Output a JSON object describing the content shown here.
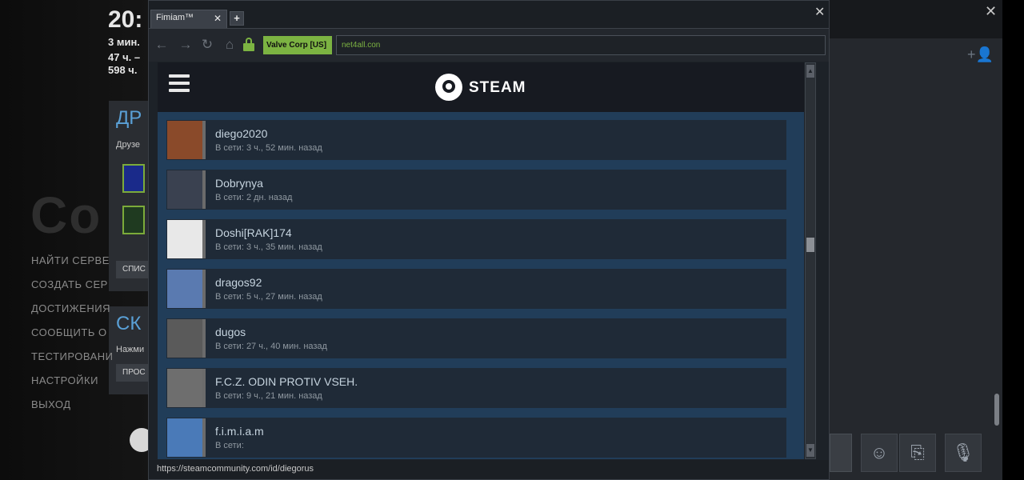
{
  "background": {
    "clock": "20:",
    "stats": [
      "3 мин.",
      "47 ч. –",
      "598 ч."
    ],
    "big_text": "Co",
    "menu": [
      "НАЙТИ СЕРВЕ",
      "СОЗДАТЬ СЕР",
      "ДОСТИЖЕНИЯ",
      "СООБЩИТЬ О",
      "ТЕСТИРОВАНИ",
      "НАСТРОЙКИ",
      "ВЫХОД"
    ],
    "friends_title": "ДР",
    "friends_sub": "Друзе",
    "friends_button": "СПИС",
    "section2_title": "СК",
    "section2_sub": "Нажми",
    "section2_button": "ПРОС"
  },
  "window": {
    "tab_label": "Fimiam™",
    "tab_close": "✕",
    "new_tab": "+",
    "close": "✕"
  },
  "navbar": {
    "back_icon": "←",
    "forward_icon": "→",
    "reload_icon": "↻",
    "home_icon": "⌂",
    "cert_label": "Valve Corp [US]",
    "url": "net4all.con"
  },
  "page": {
    "brand": "STEAM",
    "friends": [
      {
        "name": "diego2020",
        "status": "В сети: 3 ч., 52 мин. назад",
        "avatar_color": "#8a4a2a"
      },
      {
        "name": "Dobrynya",
        "status": "В сети: 2 дн. назад",
        "avatar_color": "#3a4150"
      },
      {
        "name": "Doshi[RAK]174",
        "status": "В сети: 3 ч., 35 мин. назад",
        "avatar_color": "#e8e8e8"
      },
      {
        "name": "dragos92",
        "status": "В сети: 5 ч., 27 мин. назад",
        "avatar_color": "#5a7ab0"
      },
      {
        "name": "dugos",
        "status": "В сети: 27 ч., 40 мин. назад",
        "avatar_color": "#5a5a5a"
      },
      {
        "name": "F.C.Z. ODIN PROTIV VSEH.",
        "status": "В сети: 9 ч., 21 мин. назад",
        "avatar_color": "#6e6e6e"
      },
      {
        "name": "f.i.m.i.a.m",
        "status": "В сети:",
        "avatar_color": "#4a7ab8"
      }
    ]
  },
  "statusbar": {
    "url": "https://steamcommunity.com/id/diegorus"
  },
  "chat": {
    "close": "✕",
    "buttons": [
      "☺",
      "⎘",
      "🎙"
    ]
  }
}
